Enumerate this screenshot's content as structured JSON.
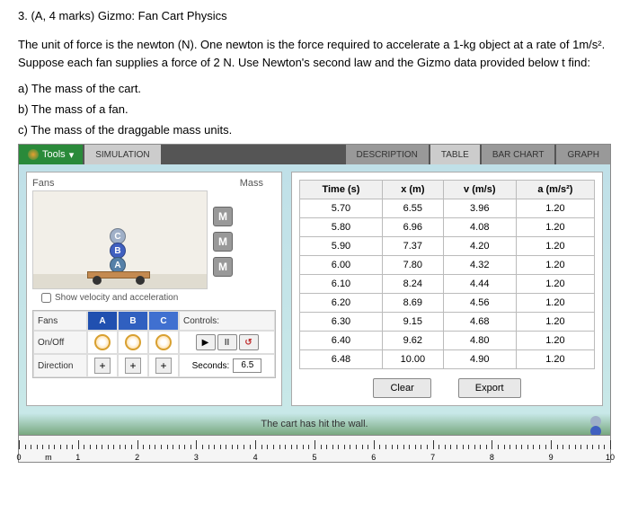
{
  "question": {
    "number": "3.",
    "marks": "(A, 4 marks) Gizmo: Fan Cart Physics",
    "body": "The unit of force is the newton (N). One newton is the force required to accelerate a 1-kg object at a rate of 1m/s². Suppose each fan supplies a force of 2 N. Use Newton's second law and the Gizmo data provided below t find:",
    "parts": {
      "a": "a)   The mass of the cart.",
      "b": "b)   The mass of a fan.",
      "c": "c)   The mass of the draggable mass units."
    }
  },
  "toolbar": {
    "tools": "Tools",
    "simulation": "SIMULATION",
    "description": "DESCRIPTION",
    "table": "TABLE",
    "barchart": "BAR CHART",
    "graph": "GRAPH"
  },
  "sim": {
    "fans_label": "Fans",
    "mass_label": "Mass",
    "mass_block": "M",
    "fan_labels": {
      "a": "A",
      "b": "B",
      "c": "C"
    },
    "checkbox": "Show velocity and acceleration",
    "controls_header": "Controls:",
    "rows": {
      "fans": "Fans",
      "onoff": "On/Off",
      "direction": "Direction"
    },
    "plus": "+",
    "play": "▶",
    "pause": "II",
    "reset": "↺",
    "seconds_label": "Seconds:",
    "seconds_value": "6.5"
  },
  "chart_data": {
    "type": "table",
    "columns": [
      "Time (s)",
      "x (m)",
      "v (m/s)",
      "a (m/s²)"
    ],
    "rows": [
      [
        "5.70",
        "6.55",
        "3.96",
        "1.20"
      ],
      [
        "5.80",
        "6.96",
        "4.08",
        "1.20"
      ],
      [
        "5.90",
        "7.37",
        "4.20",
        "1.20"
      ],
      [
        "6.00",
        "7.80",
        "4.32",
        "1.20"
      ],
      [
        "6.10",
        "8.24",
        "4.44",
        "1.20"
      ],
      [
        "6.20",
        "8.69",
        "4.56",
        "1.20"
      ],
      [
        "6.30",
        "9.15",
        "4.68",
        "1.20"
      ],
      [
        "6.40",
        "9.62",
        "4.80",
        "1.20"
      ],
      [
        "6.48",
        "10.00",
        "4.90",
        "1.20"
      ]
    ]
  },
  "buttons": {
    "clear": "Clear",
    "export": "Export"
  },
  "status": "The cart has hit the wall.",
  "ruler": {
    "ticks": [
      "0",
      "1",
      "2",
      "3",
      "4",
      "5",
      "6",
      "7",
      "8",
      "9",
      "10"
    ],
    "unit": "m"
  }
}
